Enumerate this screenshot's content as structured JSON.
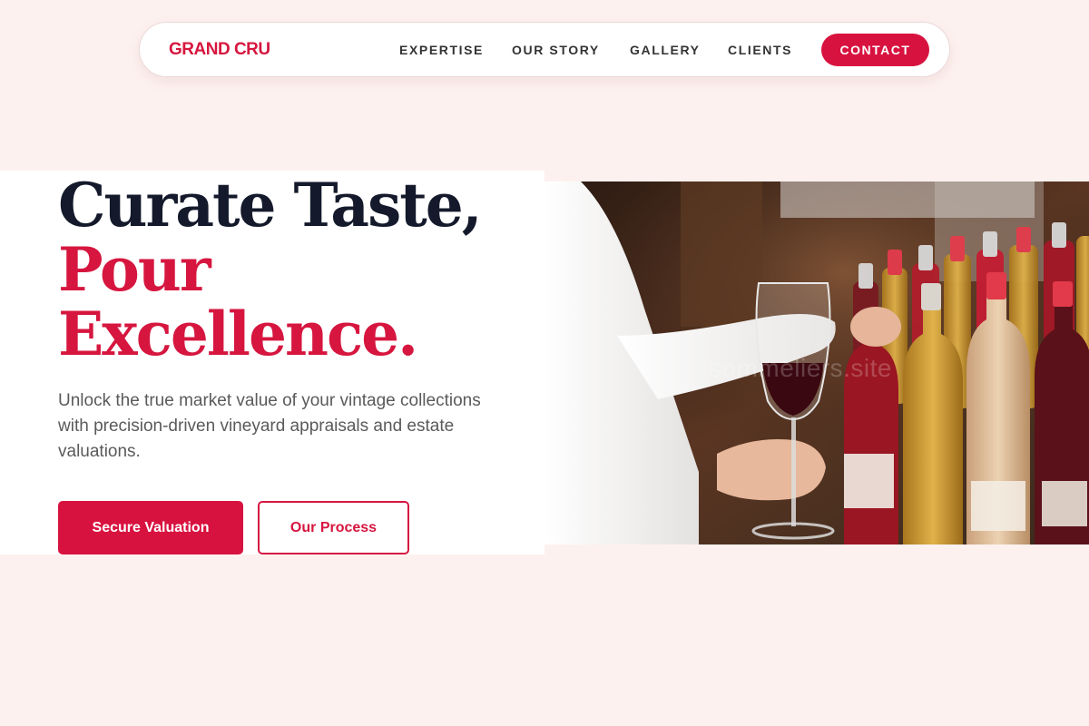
{
  "nav": {
    "brand": "GRAND CRU",
    "links": [
      "EXPERTISE",
      "OUR STORY",
      "GALLERY",
      "CLIENTS"
    ],
    "contact": "CONTACT"
  },
  "hero": {
    "headline_line1": "Curate Taste,",
    "headline_line2": "Pour",
    "headline_line3": "Excellence.",
    "subtitle": "Unlock the true market value of your vintage collections with precision-driven vineyard appraisals and estate valuations.",
    "primary_button": "Secure Valuation",
    "secondary_button": "Our Process",
    "watermark": "sommeliers.site"
  },
  "colors": {
    "accent": "#d6163f",
    "page_background": "#fdf1ef",
    "headline_dark": "#141a2b"
  }
}
